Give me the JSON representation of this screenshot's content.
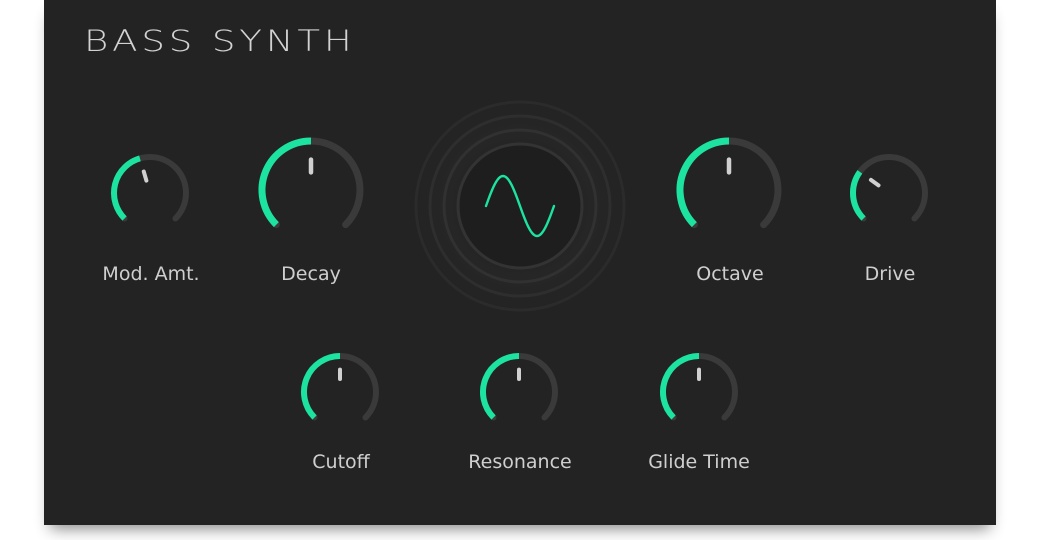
{
  "plugin": {
    "title": "BASS SYNTH",
    "colors": {
      "panel": "#232323",
      "accent": "#1de3a0",
      "track": "#3a3a3a",
      "pointer": "#d0d0d0",
      "label": "#cfcfcf"
    }
  },
  "knobs": {
    "mod_amt": {
      "label": "Mod. Amt.",
      "value": 0.44
    },
    "decay": {
      "label": "Decay",
      "value": 0.5
    },
    "octave": {
      "label": "Octave",
      "value": 0.5
    },
    "drive": {
      "label": "Drive",
      "value": 0.3
    },
    "cutoff": {
      "label": "Cutoff",
      "value": 0.5
    },
    "resonance": {
      "label": "Resonance",
      "value": 0.5
    },
    "glide": {
      "label": "Glide Time",
      "value": 0.5
    }
  },
  "oscillator": {
    "waveform": "sine-wave-icon"
  }
}
